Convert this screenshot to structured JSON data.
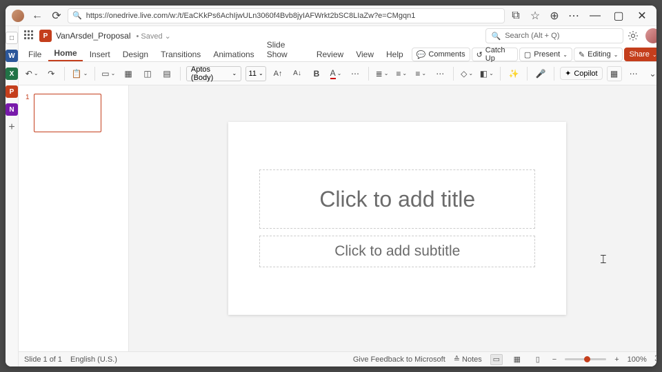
{
  "browser": {
    "url": "https://onedrive.live.com/w:/t/EaCKkPs6AchIjwULn3060f4Bvb8jyIAFWrkt2bSC8LIaZw?e=CMgqn1"
  },
  "rail": [
    {
      "bg": "#fff",
      "fg": "#555",
      "label": "□"
    },
    {
      "bg": "#2b579a",
      "fg": "#fff",
      "label": "W"
    },
    {
      "bg": "#217346",
      "fg": "#fff",
      "label": "X"
    },
    {
      "bg": "#c43e1c",
      "fg": "#fff",
      "label": "P"
    },
    {
      "bg": "#7719aa",
      "fg": "#fff",
      "label": "N"
    }
  ],
  "title": {
    "doc_name": "VanArsdel_Proposal",
    "saved": "• Saved ⌄",
    "search_placeholder": "Search (Alt + Q)"
  },
  "tabs": {
    "items": [
      "File",
      "Home",
      "Insert",
      "Design",
      "Transitions",
      "Animations",
      "Slide Show",
      "Review",
      "View",
      "Help"
    ],
    "active": 1,
    "right": {
      "comments": "Comments",
      "catchup": "Catch Up",
      "present": "Present",
      "editing": "Editing",
      "share": "Share"
    }
  },
  "ribbon": {
    "font": "Aptos (Body)",
    "size": "11",
    "copilot": "Copilot"
  },
  "slide": {
    "title_ph": "Click to add title",
    "sub_ph": "Click to add subtitle",
    "thumb_num": "1"
  },
  "status": {
    "slide": "Slide 1 of 1",
    "lang": "English (U.S.)",
    "feedback": "Give Feedback to Microsoft",
    "notes": "Notes",
    "zoom": "100%"
  }
}
